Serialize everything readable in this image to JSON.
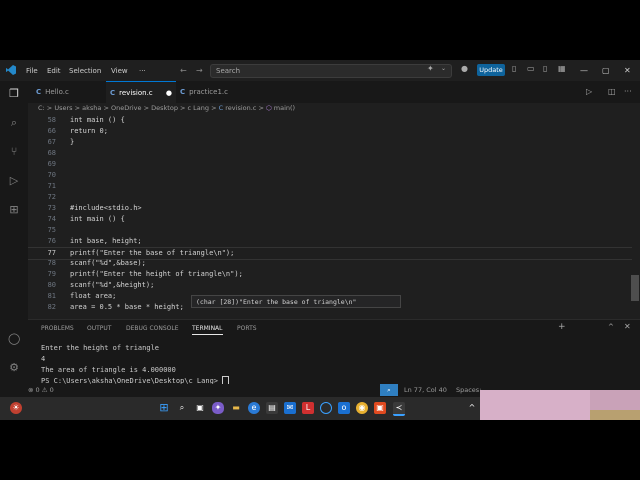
{
  "menu": [
    "File",
    "Edit",
    "Selection",
    "View",
    "···"
  ],
  "search": {
    "placeholder": "Search"
  },
  "update_label": "Update",
  "tabs": [
    {
      "label": "Hello.c"
    },
    {
      "label": "revision.c"
    },
    {
      "label": "practice1.c"
    }
  ],
  "breadcrumb": [
    "C:",
    "Users",
    "aksha",
    "OneDrive",
    "Desktop",
    "c Lang",
    "revision.c",
    "main()"
  ],
  "code": [
    {
      "n": "58",
      "t": "int main () {"
    },
    {
      "n": "66",
      "t": "return 0;"
    },
    {
      "n": "67",
      "t": "}"
    },
    {
      "n": "68",
      "t": ""
    },
    {
      "n": "69",
      "t": ""
    },
    {
      "n": "70",
      "t": ""
    },
    {
      "n": "71",
      "t": ""
    },
    {
      "n": "72",
      "t": ""
    },
    {
      "n": "73",
      "t": "#include<stdio.h>"
    },
    {
      "n": "74",
      "t": "int main () {"
    },
    {
      "n": "75",
      "t": ""
    },
    {
      "n": "76",
      "t": "int base, height;"
    },
    {
      "n": "77",
      "t": "printf(\"Enter the base of triangle\\n\");"
    },
    {
      "n": "78",
      "t": "scanf(\"%d\",&base);"
    },
    {
      "n": "79",
      "t": "printf(\"Enter the height of triangle\\n\");"
    },
    {
      "n": "80",
      "t": "scanf(\"%d\",&height);"
    },
    {
      "n": "81",
      "t": "float area;"
    },
    {
      "n": "82",
      "t": "area = 0.5 * base * height;"
    }
  ],
  "tooltip": "(char [28])\"Enter the base of triangle\\n\"",
  "panel_tabs": [
    "PROBLEMS",
    "OUTPUT",
    "DEBUG CONSOLE",
    "TERMINAL",
    "PORTS"
  ],
  "terminal": [
    "Enter the height of triangle",
    "4",
    "The area of triangle is 4.000000",
    "PS C:\\Users\\aksha\\OneDrive\\Desktop\\c Lang> "
  ],
  "status": {
    "errors": "0",
    "warnings": "0",
    "position": "Ln 77, Col 40",
    "spaces": "Spaces:"
  },
  "taskbar_icons": [
    "windows-icon",
    "search-icon",
    "task-view-icon",
    "copilot-icon",
    "file-explorer-icon",
    "edge-icon",
    "store-icon",
    "mail-icon",
    "l-app-icon",
    "cortana-icon",
    "outlook-icon",
    "chrome-icon",
    "office-icon",
    "vscode-icon"
  ]
}
